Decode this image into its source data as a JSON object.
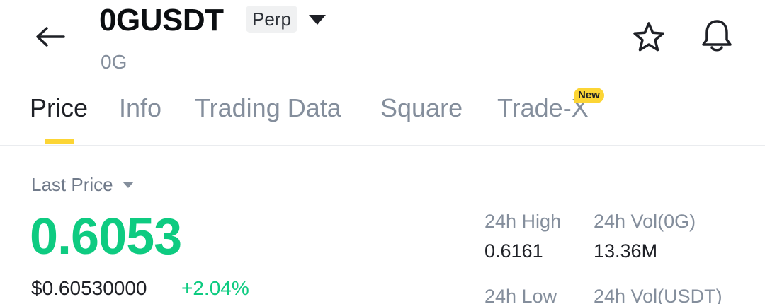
{
  "header": {
    "symbol": "0GUSDT",
    "badge": "Perp",
    "subtitle": "0G"
  },
  "tabs": [
    {
      "label": "Price",
      "active": true
    },
    {
      "label": "Info",
      "active": false
    },
    {
      "label": "Trading Data",
      "active": false
    },
    {
      "label": "Square",
      "active": false
    },
    {
      "label": "Trade-X",
      "active": false,
      "badge": "New"
    }
  ],
  "price": {
    "label": "Last Price",
    "last": "0.6053",
    "usd": "$0.60530000",
    "change": "+2.04%"
  },
  "stats": {
    "high_label": "24h High",
    "high_value": "0.6161",
    "vol_base_label": "24h Vol(0G)",
    "vol_base_value": "13.36M",
    "low_label": "24h Low",
    "vol_quote_label": "24h Vol(USDT)"
  },
  "colors": {
    "up": "#0ecb81",
    "accent": "#fcd535",
    "muted": "#848e9c"
  },
  "icons": [
    "back-arrow-icon",
    "caret-down-icon",
    "star-icon",
    "bell-icon"
  ]
}
